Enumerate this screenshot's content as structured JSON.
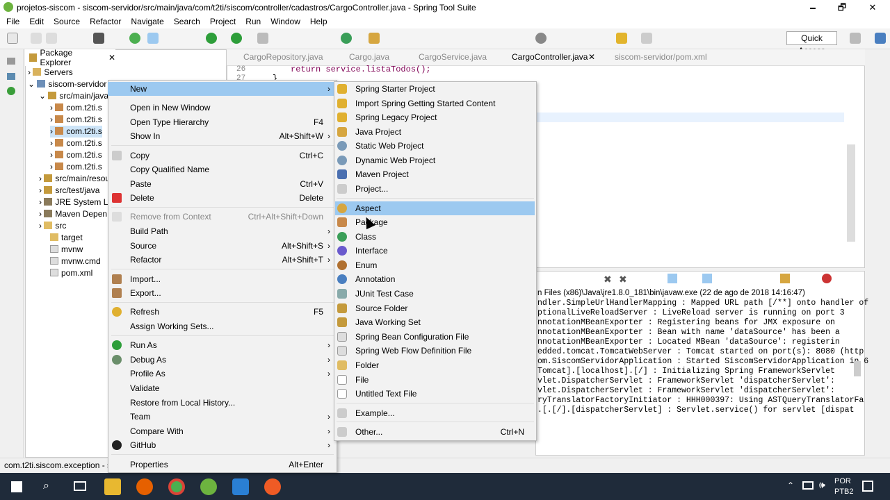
{
  "window": {
    "title": "projetos-siscom - siscom-servidor/src/main/java/com/t2ti/siscom/controller/cadastros/CargoController.java - Spring Tool Suite",
    "minimize": "🗕",
    "restore": "🗗",
    "close": "✕"
  },
  "menubar": [
    "File",
    "Edit",
    "Source",
    "Refactor",
    "Navigate",
    "Search",
    "Project",
    "Run",
    "Window",
    "Help"
  ],
  "quick_access": "Quick Access",
  "package_explorer": {
    "title": "Package Explorer",
    "tree": [
      {
        "label": "Servers"
      },
      {
        "label": "siscom-servidor"
      },
      {
        "label": "src/main/java"
      },
      {
        "label": "com.t2ti.s"
      },
      {
        "label": "com.t2ti.s"
      },
      {
        "label": "com.t2ti.s"
      },
      {
        "label": "com.t2ti.s"
      },
      {
        "label": "com.t2ti.s"
      },
      {
        "label": "com.t2ti.s"
      },
      {
        "label": "src/main/resources"
      },
      {
        "label": "src/test/java"
      },
      {
        "label": "JRE System Li"
      },
      {
        "label": "Maven Depen"
      },
      {
        "label": "src"
      },
      {
        "label": "target"
      },
      {
        "label": "mvnw"
      },
      {
        "label": "mvnw.cmd"
      },
      {
        "label": "pom.xml"
      }
    ]
  },
  "editor": {
    "tabs": [
      "CargoRepository.java",
      "Cargo.java",
      "CargoService.java",
      "CargoController.java",
      "siscom-servidor/pom.xml"
    ],
    "active_tab": "CargoController.java",
    "lines": [
      {
        "num": "26",
        "code": "return service.listaTodos();"
      },
      {
        "num": "27",
        "code": "}"
      }
    ]
  },
  "console": {
    "header": "n Files (x86)\\Java\\jre1.8.0_181\\bin\\javaw.exe (22 de ago de 2018 14:16:47)",
    "lines": [
      "ndler.SimpleUrlHandlerMapping  : Mapped URL path [/**] onto handler of",
      "ptionalLiveReloadServer        : LiveReload server is running on port 3",
      "nnotationMBeanExporter         : Registering beans for JMX exposure on",
      "nnotationMBeanExporter         : Bean with name 'dataSource' has been a",
      "nnotationMBeanExporter         : Located MBean 'dataSource': registerin",
      "edded.tomcat.TomcatWebServer   : Tomcat started on port(s): 8080 (http",
      "om.SiscomServidorApplication   : Started SiscomServidorApplication in 6",
      "Tomcat].[localhost].[/]        : Initializing Spring FrameworkServlet",
      "vlet.DispatcherServlet         : FrameworkServlet 'dispatcherServlet':",
      "vlet.DispatcherServlet         : FrameworkServlet 'dispatcherServlet':",
      "ryTranslatorFactoryInitiator   : HHH000397: Using ASTQueryTranslatorFa",
      ".[.[/].[dispatcherServlet]     : Servlet.service() for servlet [dispat"
    ]
  },
  "status": {
    "text": "com.t2ti.siscom.exception - si"
  },
  "context_menu": {
    "items": [
      {
        "label": "New",
        "shortcut": "",
        "arrow": "›",
        "highlight": true
      },
      {
        "label": "Open in New Window",
        "shortcut": ""
      },
      {
        "label": "Open Type Hierarchy",
        "shortcut": "F4"
      },
      {
        "label": "Show In",
        "shortcut": "Alt+Shift+W",
        "arrow": "›"
      },
      {
        "label": "Copy",
        "shortcut": "Ctrl+C"
      },
      {
        "label": "Copy Qualified Name",
        "shortcut": ""
      },
      {
        "label": "Paste",
        "shortcut": "Ctrl+V"
      },
      {
        "label": "Delete",
        "shortcut": "Delete"
      },
      {
        "label": "Remove from Context",
        "shortcut": "Ctrl+Alt+Shift+Down",
        "disabled": true
      },
      {
        "label": "Build Path",
        "shortcut": "",
        "arrow": "›"
      },
      {
        "label": "Source",
        "shortcut": "Alt+Shift+S",
        "arrow": "›"
      },
      {
        "label": "Refactor",
        "shortcut": "Alt+Shift+T",
        "arrow": "›"
      },
      {
        "label": "Import...",
        "shortcut": ""
      },
      {
        "label": "Export...",
        "shortcut": ""
      },
      {
        "label": "Refresh",
        "shortcut": "F5"
      },
      {
        "label": "Assign Working Sets...",
        "shortcut": ""
      },
      {
        "label": "Run As",
        "shortcut": "",
        "arrow": "›"
      },
      {
        "label": "Debug As",
        "shortcut": "",
        "arrow": "›"
      },
      {
        "label": "Profile As",
        "shortcut": "",
        "arrow": "›"
      },
      {
        "label": "Validate",
        "shortcut": ""
      },
      {
        "label": "Restore from Local History...",
        "shortcut": ""
      },
      {
        "label": "Team",
        "shortcut": "",
        "arrow": "›"
      },
      {
        "label": "Compare With",
        "shortcut": "",
        "arrow": "›"
      },
      {
        "label": "GitHub",
        "shortcut": "",
        "arrow": "›"
      },
      {
        "label": "Properties",
        "shortcut": "Alt+Enter"
      }
    ]
  },
  "new_submenu": {
    "items": [
      {
        "label": "Spring Starter Project"
      },
      {
        "label": "Import Spring Getting Started Content"
      },
      {
        "label": "Spring Legacy Project"
      },
      {
        "label": "Java Project"
      },
      {
        "label": "Static Web Project"
      },
      {
        "label": "Dynamic Web Project"
      },
      {
        "label": "Maven Project"
      },
      {
        "label": "Project..."
      },
      {
        "label": "Aspect",
        "highlight": true
      },
      {
        "label": "Package"
      },
      {
        "label": "Class"
      },
      {
        "label": "Interface"
      },
      {
        "label": "Enum"
      },
      {
        "label": "Annotation"
      },
      {
        "label": "JUnit Test Case"
      },
      {
        "label": "Source Folder"
      },
      {
        "label": "Java Working Set"
      },
      {
        "label": "Spring Bean Configuration File"
      },
      {
        "label": "Spring Web Flow Definition File"
      },
      {
        "label": "Folder"
      },
      {
        "label": "File"
      },
      {
        "label": "Untitled Text File"
      },
      {
        "label": "Example..."
      },
      {
        "label": "Other...",
        "shortcut": "Ctrl+N"
      }
    ]
  },
  "taskbar": {
    "lang": "POR",
    "layout": "PTB2"
  },
  "colors": {
    "highlight": "#9cc9f0",
    "taskbar": "#1f2b3a"
  }
}
